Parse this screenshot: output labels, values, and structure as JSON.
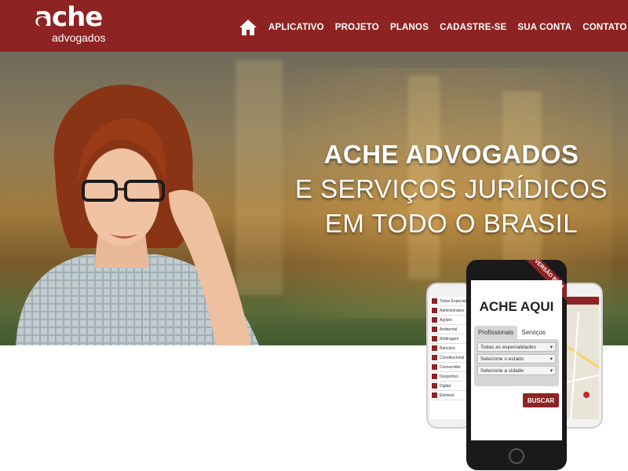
{
  "brand": {
    "logo_big": "ache",
    "logo_small": "advogados"
  },
  "nav": {
    "home_icon": "home-icon",
    "items": [
      "APLICATIVO",
      "PROJETO",
      "PLANOS",
      "CADASTRE-SE",
      "SUA CONTA",
      "CONTATO"
    ]
  },
  "hero": {
    "line1": "ACHE ADVOGADOS",
    "line2": "E SERVIÇOS JURÍDICOS",
    "line3": "EM TODO O BRASIL"
  },
  "app": {
    "ribbon": "VERSÃO BETA",
    "title": "ACHE AQUI",
    "tabs": [
      "Profissionais",
      "Serviços"
    ],
    "selects": [
      "Todas as especialidades",
      "Selecione o estado",
      "Selecione a cidade"
    ],
    "button": "BUSCAR",
    "left_list": [
      "Todas Especialid",
      "Administrativo",
      "Agrário",
      "Ambiental",
      "Arbitragem",
      "Bancário",
      "Constitucional",
      "Consumidor",
      "Desportivo",
      "Digital",
      "Eleitoral"
    ]
  },
  "colors": {
    "brand": "#8e2323",
    "white": "#ffffff"
  }
}
